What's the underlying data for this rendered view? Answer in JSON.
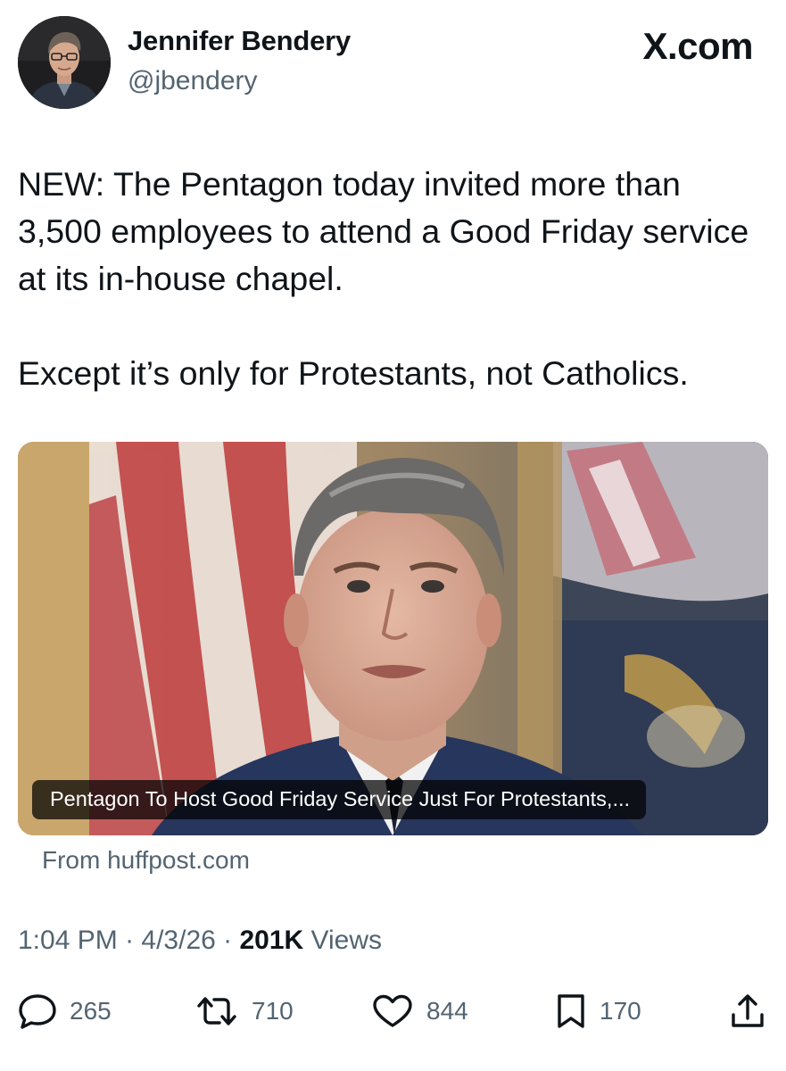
{
  "author": {
    "name": "Jennifer Bendery",
    "handle": "@jbendery"
  },
  "brand": "X.com",
  "tweet": {
    "paragraph1": "NEW: The Pentagon today invited more than 3,500 employees to attend a Good Friday service at its in-house chapel.",
    "paragraph2": "Except it’s only for Protestants, not Catholics."
  },
  "card": {
    "headline": "Pentagon To Host Good Friday Service Just For Protestants,...",
    "source": "From huffpost.com"
  },
  "meta": {
    "time": "1:04 PM",
    "date": "4/3/26",
    "separator": " · ",
    "views_count": "201K",
    "views_label": " Views"
  },
  "stats": {
    "replies": "265",
    "reposts": "710",
    "likes": "844",
    "bookmarks": "170"
  },
  "icons": [
    "reply-icon",
    "repost-icon",
    "like-icon",
    "bookmark-icon",
    "share-icon"
  ]
}
